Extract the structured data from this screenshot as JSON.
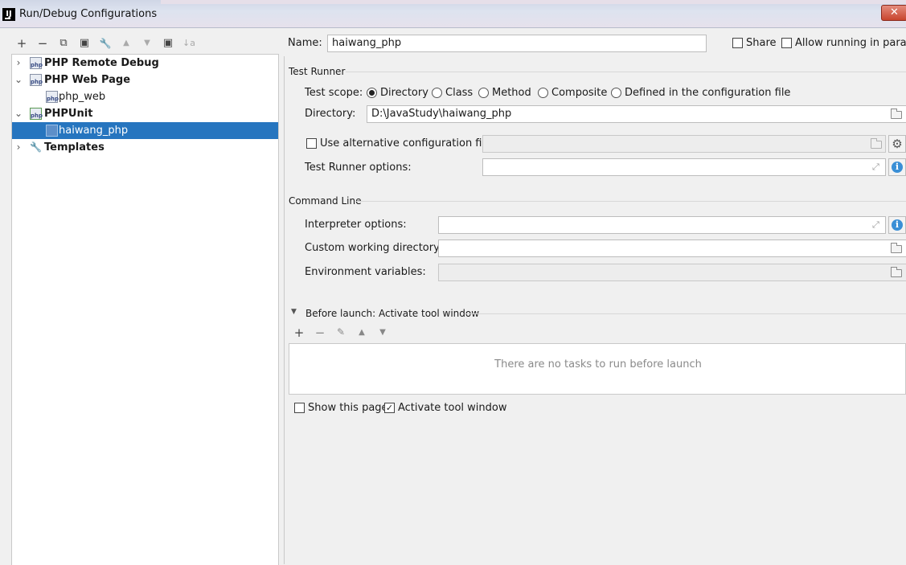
{
  "window": {
    "title": "Run/Debug Configurations",
    "close_label": "✕",
    "app_icon_label": "IJ"
  },
  "toolbar": {
    "add": "+",
    "remove": "−",
    "copy": "⧉",
    "save": "▣",
    "edit_defaults": "🔧",
    "move_up": "▲",
    "move_down": "▼",
    "new_folder": "▣",
    "sort": "↓a"
  },
  "tree": {
    "items": [
      {
        "label": "PHP Remote Debug",
        "arrow": "›",
        "bold": true,
        "icon": "php-remote-debug-icon"
      },
      {
        "label": "PHP Web Page",
        "arrow": "⌄",
        "bold": true,
        "icon": "php-web-page-icon"
      },
      {
        "label": "php_web",
        "bold": false,
        "icon": "php-file-icon"
      },
      {
        "label": "PHPUnit",
        "arrow": "⌄",
        "bold": true,
        "icon": "phpunit-icon"
      },
      {
        "label": "haiwang_php",
        "bold": false,
        "selected": true,
        "icon": "phpunit-config-icon"
      },
      {
        "label": "Templates",
        "arrow": "›",
        "bold": true,
        "icon": "wrench-icon"
      }
    ]
  },
  "header": {
    "name_label": "Name:",
    "name_value": "haiwang_php",
    "share_label": "Share",
    "allow_parallel_label": "Allow running in paralle"
  },
  "test_runner": {
    "section_label": "Test Runner",
    "scope_label": "Test scope:",
    "scopes": [
      "Directory",
      "Class",
      "Method",
      "Composite",
      "Defined in the configuration file"
    ],
    "selected_scope": "Directory",
    "directory_label": "Directory:",
    "directory_value": "D:\\JavaStudy\\haiwang_php",
    "alt_config_label": "Use alternative configuration file:",
    "options_label": "Test Runner options:"
  },
  "command_line": {
    "section_label": "Command Line",
    "interpreter_label": "Interpreter options:",
    "working_dir_label": "Custom working directory:",
    "env_label": "Environment variables:"
  },
  "before_launch": {
    "label": "Before launch: Activate tool window",
    "empty_message": "There are no tasks to run before launch",
    "show_page_label": "Show this page",
    "show_page_checked": false,
    "activate_label": "Activate tool window",
    "activate_checked": true,
    "checked_mark": "✓"
  }
}
